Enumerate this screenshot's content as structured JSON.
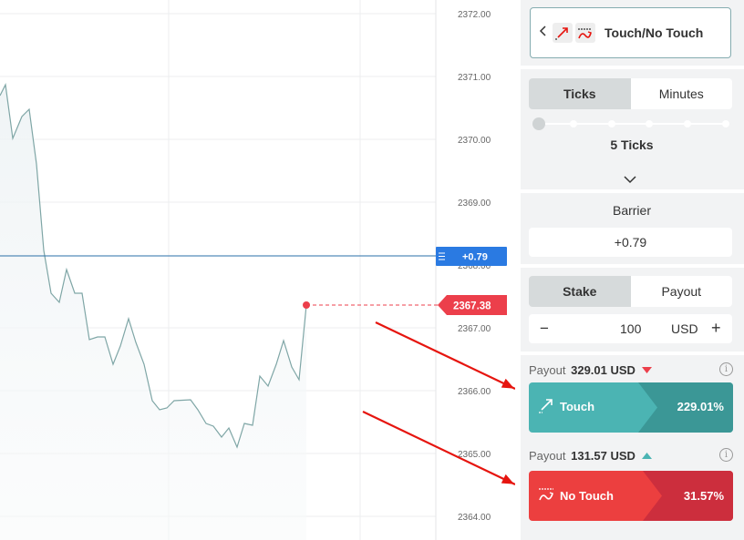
{
  "colors": {
    "price_line": "#7fa6a6",
    "barrier_line": "#2a6fa8",
    "barrier_tag": "#2a7ae2",
    "spot": "#ec3f4b",
    "touch_main": "#4bb4b3",
    "touch_dark": "#3b9796",
    "notouch_main": "#ec3f3f",
    "notouch_dark": "#cc2e3d",
    "annotation_arrow": "#e6150f"
  },
  "chart": {
    "y_ticks": [
      "2372.00",
      "2371.00",
      "2370.00",
      "2369.00",
      "2368.00",
      "2367.00",
      "2366.00",
      "2365.00",
      "2364.00"
    ],
    "barrier_label": "+0.79",
    "spot_label": "2367.38"
  },
  "trade_type": {
    "label": "Touch/No Touch",
    "back_icon": "chevron-left-icon",
    "icons": [
      "touch-icon",
      "no-touch-icon"
    ]
  },
  "duration": {
    "tabs": [
      "Ticks",
      "Minutes"
    ],
    "active_tab": "Ticks",
    "value_label": "5 Ticks",
    "slider_value": 5,
    "expand_icon": "chevron-down-icon"
  },
  "barrier": {
    "title": "Barrier",
    "value": "+0.79"
  },
  "stake": {
    "tabs": [
      "Stake",
      "Payout"
    ],
    "active_tab": "Stake",
    "minus": "−",
    "amount": "100",
    "currency": "USD",
    "plus": "+"
  },
  "touch": {
    "payout_prefix": "Payout",
    "payout_value": "329.01 USD",
    "trend_icon": "down-arrow-icon",
    "button_label": "Touch",
    "percent": "229.01%",
    "info": "i"
  },
  "no_touch": {
    "payout_prefix": "Payout",
    "payout_value": "131.57 USD",
    "trend_icon": "up-arrow-icon",
    "button_label": "No Touch",
    "percent": "31.57%",
    "info": "i"
  }
}
